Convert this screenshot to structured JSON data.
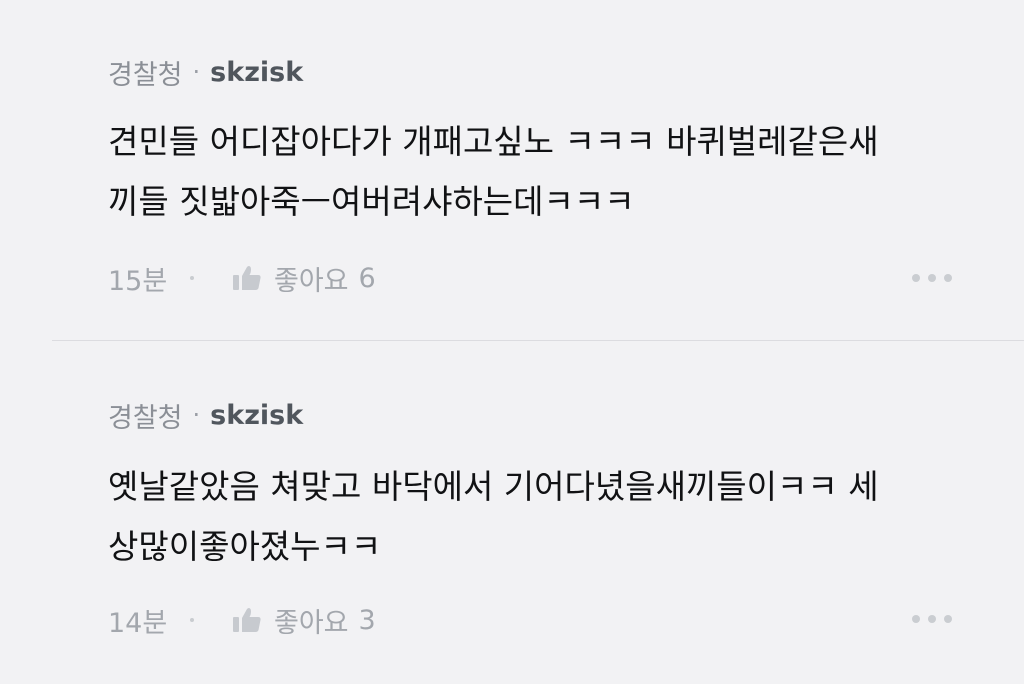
{
  "comments": [
    {
      "source": "경찰청",
      "separator": "·",
      "author": "skzisk",
      "text": "견민들 어디잡아다가 개패고싶노 ㅋㅋㅋ 바퀴벌레같은새\n끼들 짓밟아죽ㅡ여버려샤하는데ㅋㅋㅋ",
      "time": "15분",
      "like_label": "좋아요",
      "like_count": "6",
      "like_icon": "thumbs-up-icon",
      "more_icon": "more-icon"
    },
    {
      "source": "경찰청",
      "separator": "·",
      "author": "skzisk",
      "text": "옛날같았음 쳐맞고 바닥에서 기어다녔을새끼들이ㅋㅋ 세\n상많이좋아졌누ㅋㅋ",
      "time": "14분",
      "like_label": "좋아요",
      "like_count": "3",
      "like_icon": "thumbs-up-icon",
      "more_icon": "more-icon"
    }
  ],
  "colors": {
    "background": "#f2f2f4",
    "author": "#50565d",
    "meta": "#8b8f96",
    "body": "#111214",
    "footer": "#a3a7ad"
  }
}
